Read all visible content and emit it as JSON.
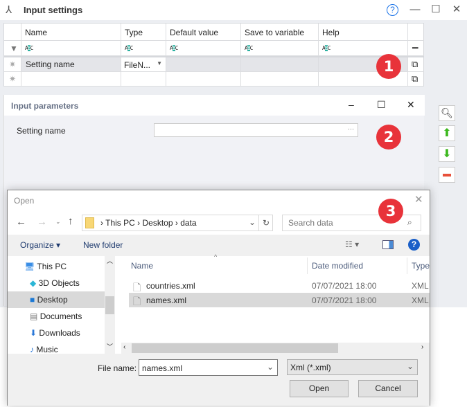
{
  "window": {
    "title": "Input settings",
    "help": "?",
    "minimize": "—",
    "maximize": "☐",
    "close": "✕"
  },
  "grid": {
    "columns": [
      "Name",
      "Type",
      "Default value",
      "Save to variable",
      "Help"
    ],
    "filter_glyph": "ABC",
    "menu_glyph": "═",
    "rows": [
      {
        "name": "Setting name",
        "type": "FileN...",
        "default": "",
        "save": "",
        "help": ""
      }
    ],
    "new_row_glyph": "✷",
    "current_row_glyph": "→"
  },
  "badges": [
    "1",
    "2",
    "3"
  ],
  "params": {
    "title": "Input parameters",
    "field_label": "Setting name",
    "field_value": "",
    "ellipsis": "···"
  },
  "side_buttons": {
    "search": "search",
    "up": "move-up",
    "down": "move-down",
    "remove": "remove"
  },
  "dialog": {
    "title": "Open",
    "close": "✕",
    "breadcrumb": [
      "This PC",
      "Desktop",
      "data"
    ],
    "search_placeholder": "Search data",
    "organize": "Organize ▾",
    "new_folder": "New folder",
    "nav": [
      "This PC",
      "3D Objects",
      "Desktop",
      "Documents",
      "Downloads",
      "Music"
    ],
    "headers": [
      "Name",
      "Date modified",
      "Type"
    ],
    "files": [
      {
        "name": "countries.xml",
        "date": "07/07/2021 18:00",
        "type": "XML"
      },
      {
        "name": "names.xml",
        "date": "07/07/2021 18:00",
        "type": "XML"
      }
    ],
    "file_name_label": "File name:",
    "file_name": "names.xml",
    "filter": "Xml (*.xml)",
    "open": "Open",
    "cancel": "Cancel"
  },
  "colors": {
    "badge": "#e8333a",
    "selection": "#d9d9d9",
    "accent": "#1a73e8"
  }
}
